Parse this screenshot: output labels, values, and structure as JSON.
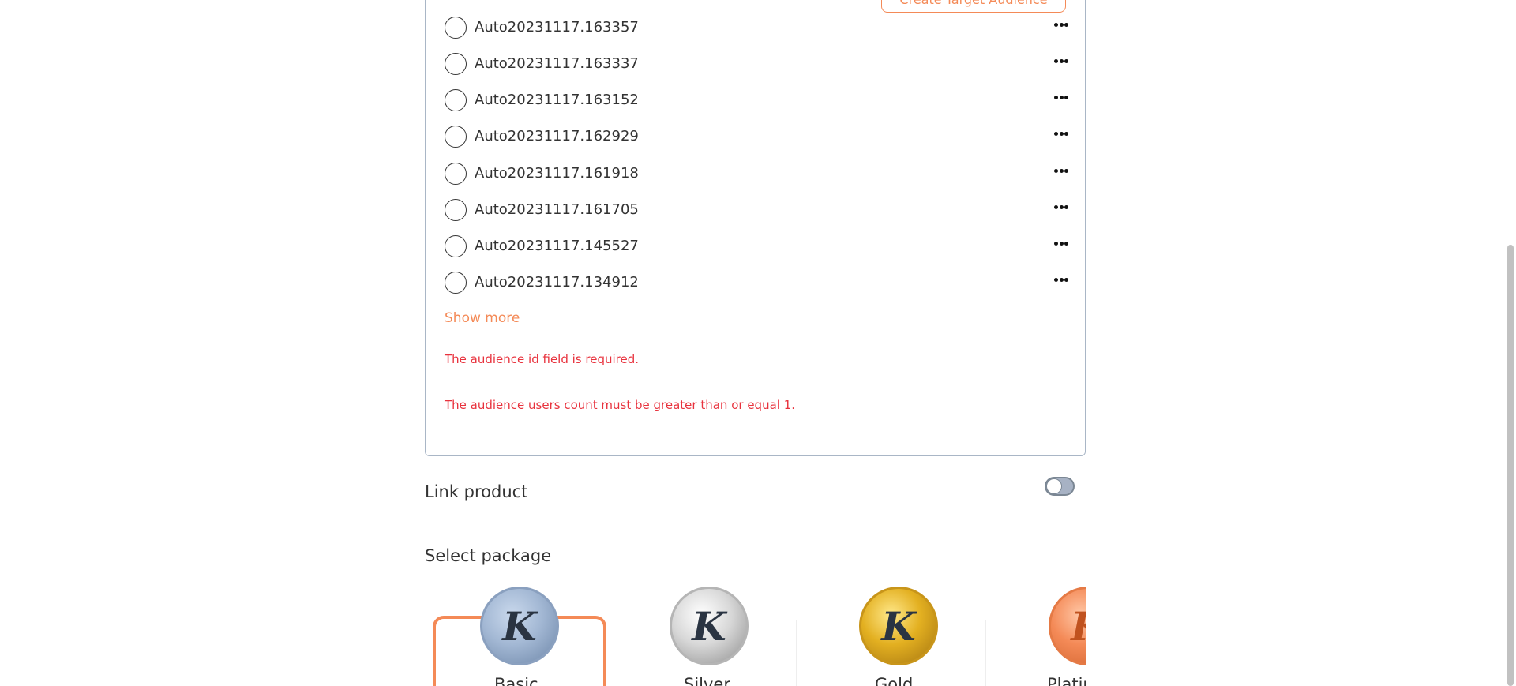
{
  "create_button_label": "Create Target Audience",
  "audiences": [
    {
      "name": "Auto20231117.163357"
    },
    {
      "name": "Auto20231117.163337"
    },
    {
      "name": "Auto20231117.163152"
    },
    {
      "name": "Auto20231117.162929"
    },
    {
      "name": "Auto20231117.161918"
    },
    {
      "name": "Auto20231117.161705"
    },
    {
      "name": "Auto20231117.145527"
    },
    {
      "name": "Auto20231117.134912"
    }
  ],
  "show_more_label": "Show more",
  "errors": [
    "The audience id field is required.",
    "The audience users count must be greater than or equal 1."
  ],
  "link_product": {
    "label": "Link product",
    "enabled": false
  },
  "select_package": {
    "title": "Select package",
    "packages": [
      {
        "name": "Basic",
        "selected": true,
        "color": "#a3b8d4"
      },
      {
        "name": "Silver",
        "selected": false,
        "color": "#d8d8d8"
      },
      {
        "name": "Gold",
        "selected": false,
        "color": "#e3b021"
      },
      {
        "name": "Platinum",
        "selected": false,
        "color": "#f48a57"
      }
    ]
  },
  "colors": {
    "accent": "#f48a57",
    "error": "#e8323d",
    "border": "#a9b6c6"
  }
}
